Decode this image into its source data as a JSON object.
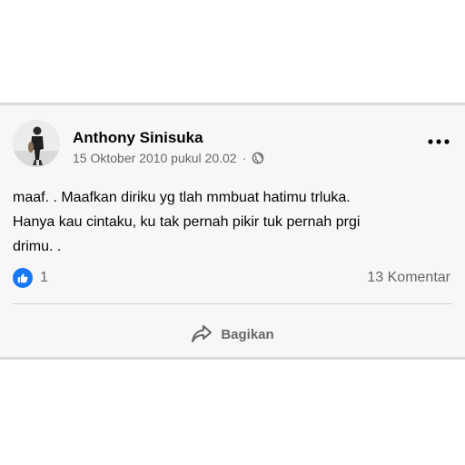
{
  "post": {
    "author": "Anthony Sinisuka",
    "timestamp": "15 Oktober 2010 pukul 20.02",
    "separator": "·",
    "privacy_icon": "globe-icon",
    "text": "maaf. . Maafkan diriku yg tlah mmbuat hatimu trluka.\nHanya kau cintaku, ku tak pernah pikir tuk pernah prgi\ndrimu. .",
    "reactions": {
      "icon": "like-icon",
      "count": "1"
    },
    "comments_label": "13 Komentar",
    "share_label": "Bagikan",
    "more_icon": "more-options-icon"
  },
  "colors": {
    "card_background": "#f7f7f7",
    "border": "#dadada",
    "text_primary": "#050505",
    "text_secondary": "#65676b",
    "like_blue": "#1877f2"
  }
}
